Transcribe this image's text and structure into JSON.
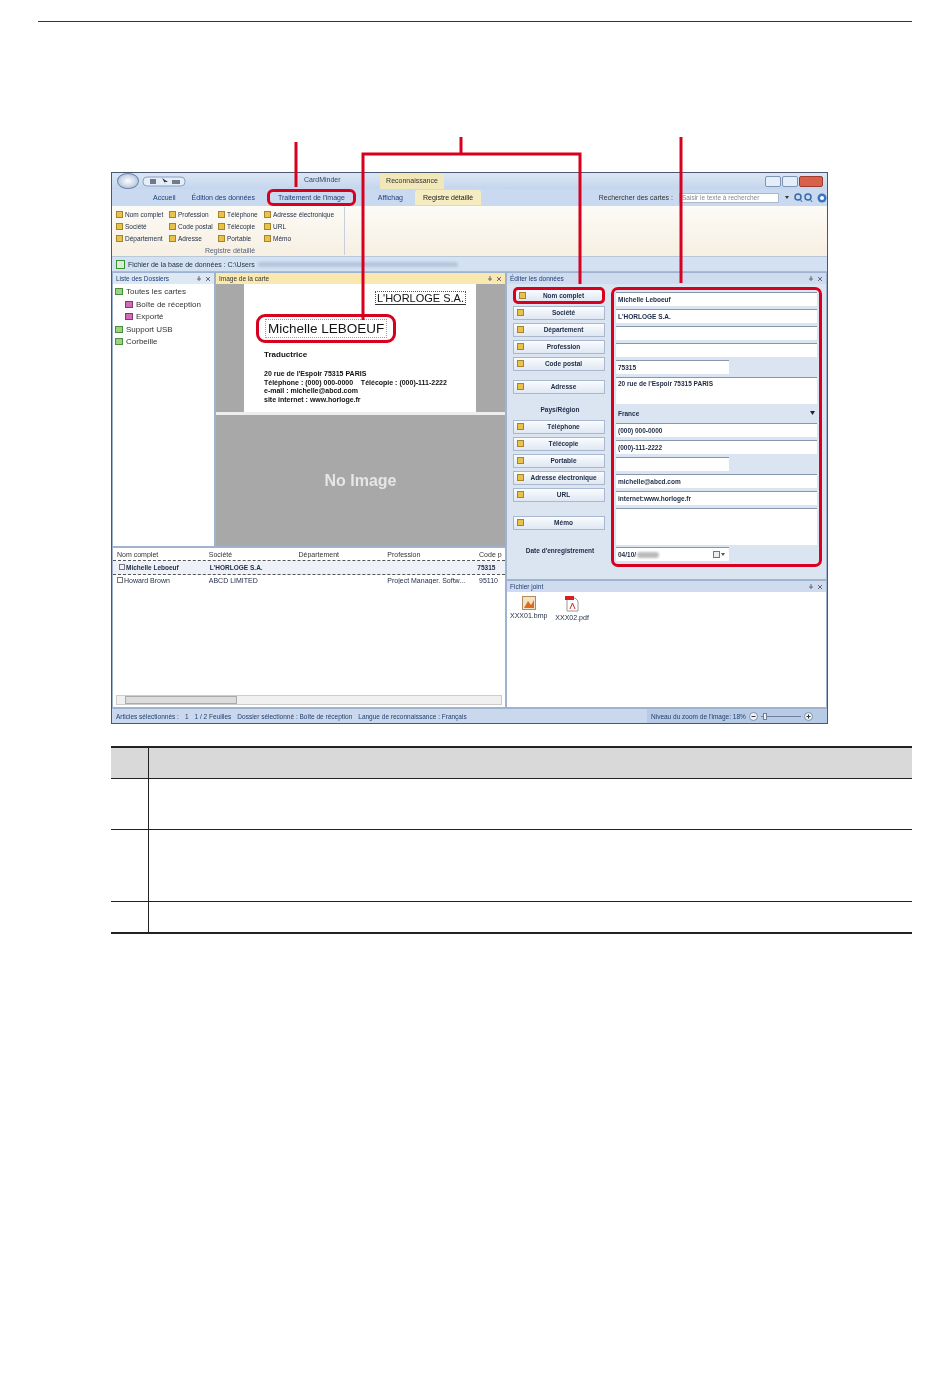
{
  "window": {
    "title": "CardMinder",
    "context_tab": "Reconnaissance"
  },
  "tabs": [
    {
      "label": "Accueil",
      "selected": false,
      "highlighted": false
    },
    {
      "label": "Édition des données",
      "selected": false,
      "highlighted": false
    },
    {
      "label": "Traitement de l'image",
      "selected": false,
      "highlighted": true
    },
    {
      "label": "Affichag",
      "selected": false,
      "highlighted": false
    },
    {
      "label": "Registre détaillé",
      "selected": true,
      "highlighted": false
    }
  ],
  "search": {
    "label": "Rechercher des cartes :",
    "placeholder": "Saisir le texte à rechercher"
  },
  "ribbon": {
    "group_label": "Registre détaillé",
    "items": [
      "Nom complet",
      "Profession",
      "Téléphone",
      "Adresse électronique",
      "Société",
      "Code postal",
      "Télécopie",
      "URL",
      "Département",
      "Adresse",
      "Portable",
      "Mémo"
    ]
  },
  "path_bar": {
    "label": "Fichier de la base de données : C:\\Users"
  },
  "folders": {
    "title": "Liste des Dossiers",
    "items": [
      {
        "label": "Toutes les cartes",
        "children": [
          {
            "label": "Boîte de réception"
          },
          {
            "label": "Exporté"
          }
        ]
      },
      {
        "label": "Support USB"
      },
      {
        "label": "Corbeille"
      }
    ]
  },
  "card_image": {
    "title": "Image de la carte",
    "company": "L'HORLOGE S.A.",
    "name": "Michelle LEBOEUF",
    "name_highlighted": true,
    "job": "Traductrice",
    "lines": [
      "20 rue de l'Espoir 75315 PARIS",
      "Téléphone : (000) 000-0000    Télécopie : (000)-111-2222",
      "e-mail : michelle@abcd.com",
      "site internet : www.horloge.fr"
    ],
    "back_text": "No Image"
  },
  "card_list": {
    "columns": [
      "Nom complet",
      "Société",
      "Département",
      "Profession",
      "Code p"
    ],
    "rows": [
      {
        "name": "Michelle Leboeuf",
        "company": "L'HORLOGE S.A.",
        "postal": "75315",
        "selected": true
      },
      {
        "name": "Howard Brown",
        "company": "ABCD LIMITED",
        "profession": "Project Manager. Softw...",
        "postal": "95110",
        "selected": false
      }
    ]
  },
  "edit_panel": {
    "title": "Éditer les données",
    "fields_highlighted": true,
    "fields": [
      {
        "label": "Nom complet",
        "kind": "text",
        "value": "Michelle Leboeuf",
        "highlighted": true
      },
      {
        "label": "Société",
        "kind": "text",
        "value": "L'HORLOGE S.A.",
        "highlighted": false
      },
      {
        "label": "Département",
        "kind": "text",
        "highlighted": false
      },
      {
        "label": "Profession",
        "kind": "text",
        "highlighted": false
      },
      {
        "label": "Code postal",
        "kind": "short",
        "value": "75315",
        "highlighted": false
      },
      {
        "label": "Adresse",
        "kind": "address",
        "value": "20 rue de l'Espoir 75315 PARIS",
        "highlighted": false
      },
      {
        "label": "Pays/Région",
        "kind": "select",
        "value": "France"
      },
      {
        "label": "Téléphone",
        "kind": "text",
        "value": "(000) 000-0000",
        "highlighted": false
      },
      {
        "label": "Télécopie",
        "kind": "text",
        "value": "(000)-111-2222",
        "highlighted": false
      },
      {
        "label": "Portable",
        "kind": "short",
        "highlighted": false
      },
      {
        "label": "Adresse électronique",
        "kind": "text",
        "value": "michelle@abcd.com",
        "highlighted": false
      },
      {
        "label": "URL",
        "kind": "text",
        "value": "internet:www.horloge.fr",
        "highlighted": false
      },
      {
        "label": "Mémo",
        "kind": "memo",
        "highlighted": false
      },
      {
        "label": "Date d'enregistrement",
        "kind": "date",
        "value": "04/10/"
      }
    ]
  },
  "attachments": {
    "title": "Fichier joint",
    "files": [
      {
        "name": "XXX01.bmp",
        "kind": "image"
      },
      {
        "name": "XXX02.pdf",
        "kind": "pdf"
      }
    ]
  },
  "status_bar": {
    "items": [
      "Articles sélectionnés :",
      "1",
      "1 / 2 Feuilles",
      "Dossier sélectionné : Boîte de réception",
      "Langue de reconnaissance : Français"
    ],
    "zoom_label": "Niveau du zoom de l'image: 18%",
    "zoom": {
      "level": 0.05
    }
  }
}
